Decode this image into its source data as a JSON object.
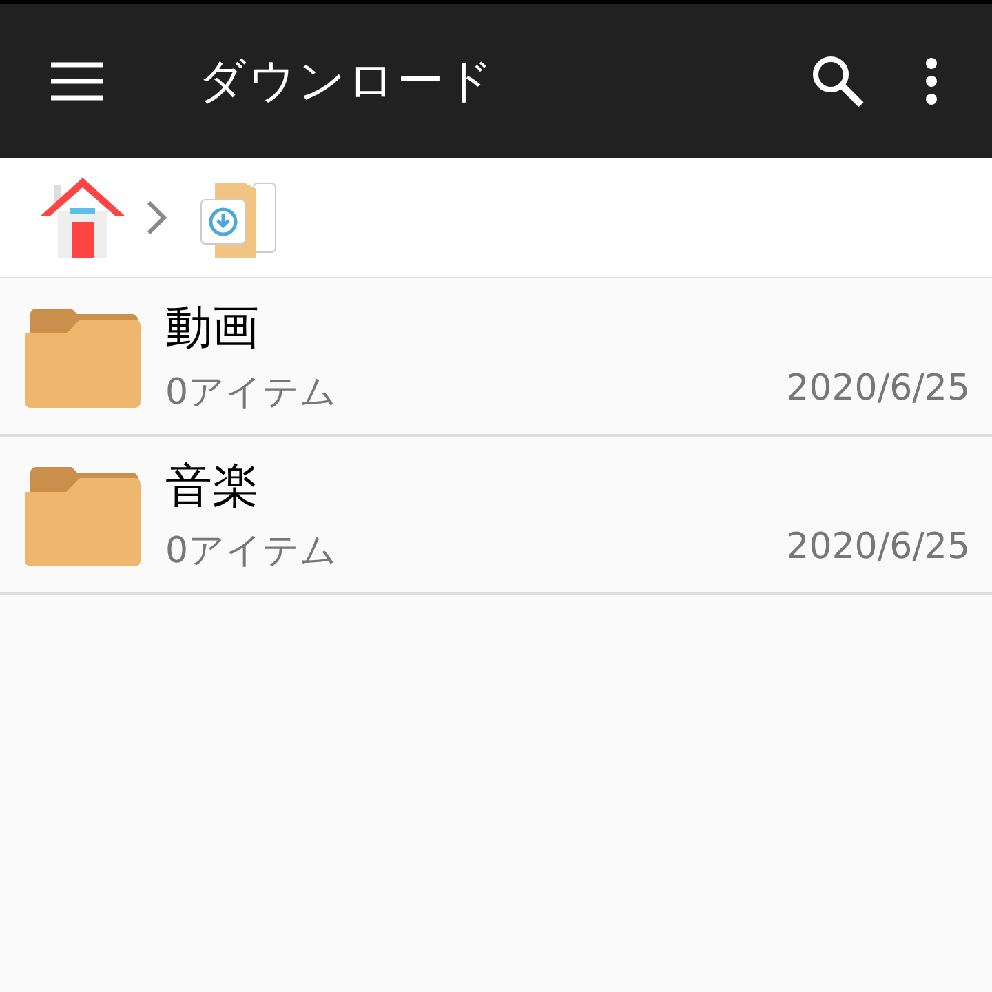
{
  "app_bar": {
    "title": "ダウンロード"
  },
  "breadcrumb": [
    {
      "kind": "home"
    },
    {
      "kind": "downloads"
    }
  ],
  "files": [
    {
      "name": "動画",
      "count": "0アイテム",
      "date": "2020/6/25"
    },
    {
      "name": "音楽",
      "count": "0アイテム",
      "date": "2020/6/25"
    }
  ]
}
